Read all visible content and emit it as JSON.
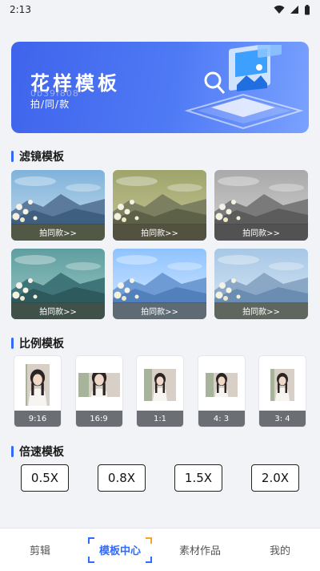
{
  "status_bar": {
    "time": "2:13"
  },
  "banner": {
    "title": "花样模板",
    "code": "0b39f808",
    "subtitle": "拍/同/款"
  },
  "sections": {
    "filters": "滤镜模板",
    "ratios": "比例模板",
    "speeds": "倍速模板"
  },
  "filters": [
    {
      "label": "拍同款>>",
      "tone": "normal"
    },
    {
      "label": "拍同款>>",
      "tone": "yellow"
    },
    {
      "label": "拍同款>>",
      "tone": "gray"
    },
    {
      "label": "拍同款>>",
      "tone": "teal"
    },
    {
      "label": "拍同款>>",
      "tone": "bright"
    },
    {
      "label": "拍同款>>",
      "tone": "pale"
    }
  ],
  "ratios": [
    {
      "label": "9:16",
      "value": "9:16"
    },
    {
      "label": "16:9",
      "value": "16:9"
    },
    {
      "label": "1:1",
      "value": "1:1"
    },
    {
      "label": "4: 3",
      "value": "4:3"
    },
    {
      "label": "3: 4",
      "value": "3:4"
    }
  ],
  "speeds": [
    "0.5X",
    "0.8X",
    "1.5X",
    "2.0X"
  ],
  "nav": {
    "items": [
      "剪辑",
      "模板中心",
      "素材作品",
      "我的"
    ],
    "active_index": 1
  },
  "colors": {
    "accent": "#2f6bff",
    "banner_start": "#3f64ec",
    "banner_end": "#7aa2ff"
  }
}
